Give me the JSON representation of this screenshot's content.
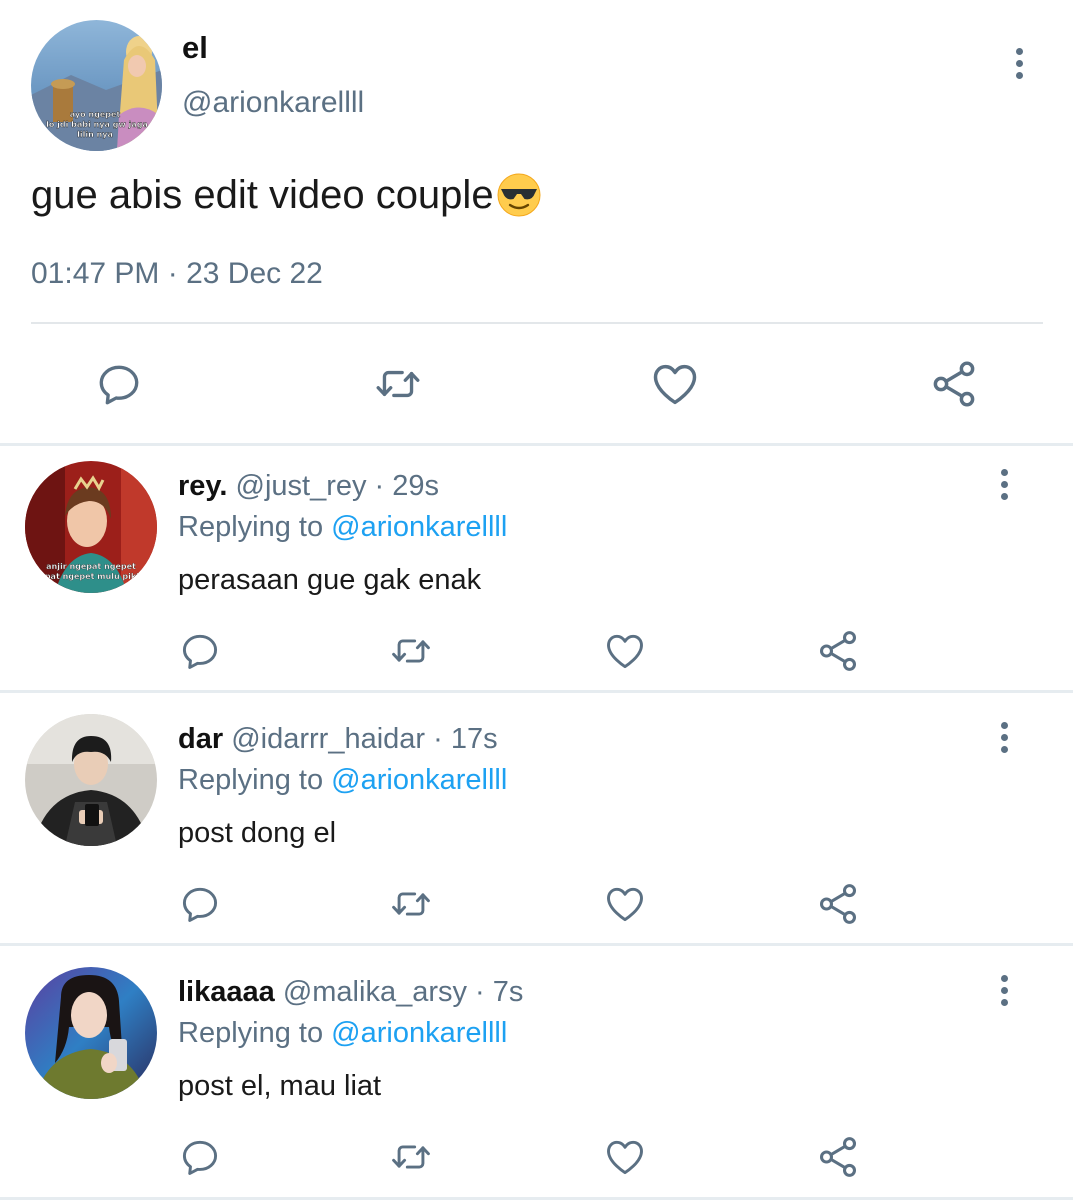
{
  "main_tweet": {
    "name": "el",
    "handle": "@arionkarellll",
    "avatar_caption": [
      "ayo ngepet",
      "lo jdi babi nya gw jaga",
      "lilin nya"
    ],
    "text": "gue abis edit video couple",
    "emoji": "smiling-face-with-sunglasses-icon",
    "timestamp": "01:47 PM · 23 Dec 22"
  },
  "replies": [
    {
      "name": "rey.",
      "handle": "@just_rey",
      "time": "29s",
      "replying_prefix": "Replying to",
      "replying_to": "@arionkarellll",
      "text": "perasaan gue gak enak",
      "avatar_caption": [
        "anjir ngepat ngepet",
        "ngepat ngepet mulu pikiran"
      ]
    },
    {
      "name": "dar",
      "handle": "@idarrr_haidar",
      "time": "17s",
      "replying_prefix": "Replying to",
      "replying_to": "@arionkarellll",
      "text": "post dong el"
    },
    {
      "name": "likaaaa",
      "handle": "@malika_arsy",
      "time": "7s",
      "replying_prefix": "Replying to",
      "replying_to": "@arionkarellll",
      "text": "post el, mau liat"
    }
  ],
  "meta_separator": " · ",
  "icons": [
    "more-icon",
    "reply-icon",
    "retweet-icon",
    "like-icon",
    "share-icon"
  ],
  "colors": {
    "text": "#1a1a1a",
    "secondary": "#5b7083",
    "link": "#1da1f2",
    "divider": "#e6ecf0"
  }
}
